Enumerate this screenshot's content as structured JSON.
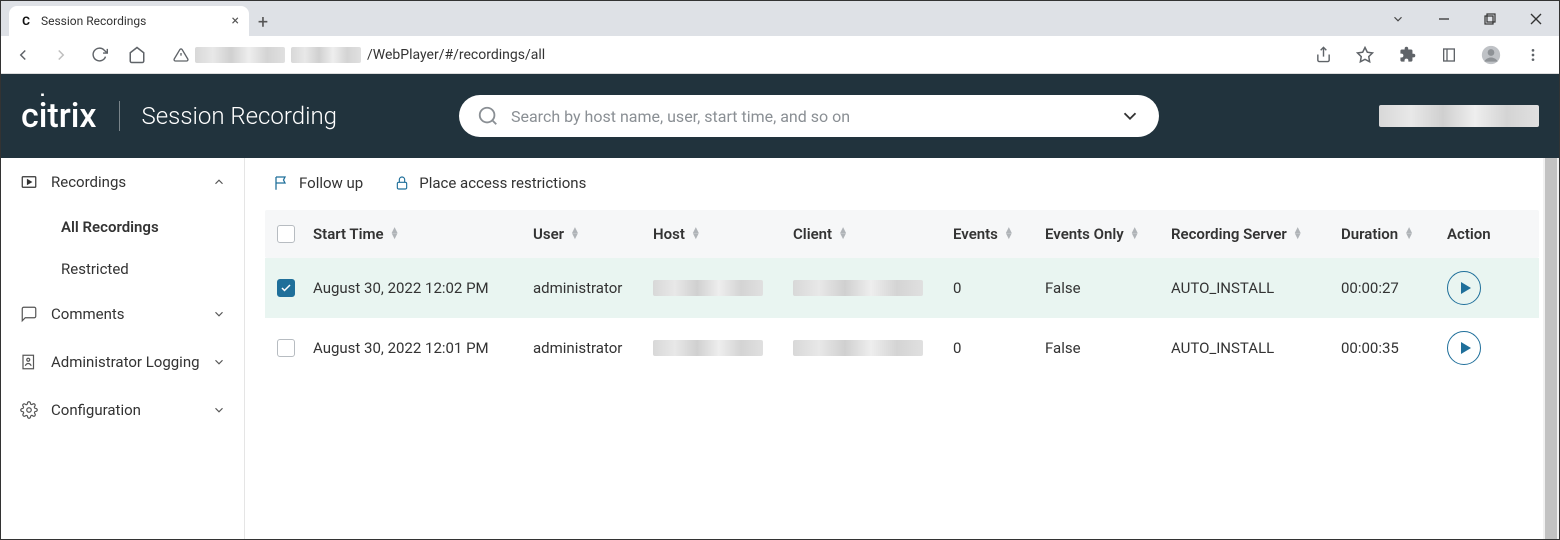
{
  "browser": {
    "tab_title": "Session Recordings",
    "url_suffix": "/WebPlayer/#/recordings/all"
  },
  "header": {
    "brand": "citrix",
    "title": "Session Recording",
    "search_placeholder": "Search by host name, user, start time, and so on"
  },
  "sidebar": {
    "recordings": "Recordings",
    "all_recordings": "All Recordings",
    "restricted": "Restricted",
    "comments": "Comments",
    "admin_logging": "Administrator Logging",
    "configuration": "Configuration"
  },
  "actions": {
    "follow_up": "Follow up",
    "place_restrictions": "Place access restrictions"
  },
  "table": {
    "headers": {
      "start_time": "Start Time",
      "user": "User",
      "host": "Host",
      "client": "Client",
      "events": "Events",
      "events_only": "Events Only",
      "recording_server": "Recording Server",
      "duration": "Duration",
      "action": "Action"
    },
    "rows": [
      {
        "checked": true,
        "start_time": "August 30, 2022 12:02 PM",
        "user": "administrator",
        "events": "0",
        "events_only": "False",
        "recording_server": "AUTO_INSTALL",
        "duration": "00:00:27"
      },
      {
        "checked": false,
        "start_time": "August 30, 2022 12:01 PM",
        "user": "administrator",
        "events": "0",
        "events_only": "False",
        "recording_server": "AUTO_INSTALL",
        "duration": "00:00:35"
      }
    ]
  }
}
